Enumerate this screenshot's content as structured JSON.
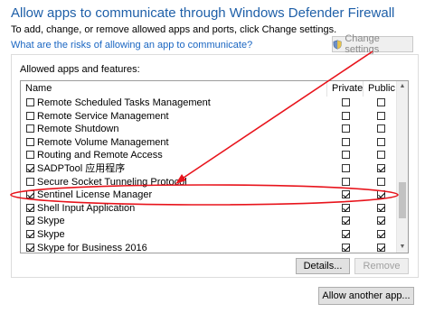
{
  "header": {
    "title": "Allow apps to communicate through Windows Defender Firewall",
    "subtitle": "To add, change, or remove allowed apps and ports, click Change settings.",
    "risk_link": "What are the risks of allowing an app to communicate?",
    "change_settings": "Change settings"
  },
  "group": {
    "label": "Allowed apps and features:",
    "columns": {
      "name": "Name",
      "private": "Private",
      "public": "Public"
    },
    "rows": [
      {
        "name": "Remote Scheduled Tasks Management",
        "enabled": false,
        "private": false,
        "public": false
      },
      {
        "name": "Remote Service Management",
        "enabled": false,
        "private": false,
        "public": false
      },
      {
        "name": "Remote Shutdown",
        "enabled": false,
        "private": false,
        "public": false
      },
      {
        "name": "Remote Volume Management",
        "enabled": false,
        "private": false,
        "public": false
      },
      {
        "name": "Routing and Remote Access",
        "enabled": false,
        "private": false,
        "public": false
      },
      {
        "name": "SADPTool 应用程序",
        "enabled": true,
        "private": false,
        "public": true
      },
      {
        "name": "Secure Socket Tunneling Protocol",
        "enabled": false,
        "private": false,
        "public": false
      },
      {
        "name": "Sentinel License Manager",
        "enabled": true,
        "private": true,
        "public": true
      },
      {
        "name": "Shell Input Application",
        "enabled": true,
        "private": true,
        "public": true
      },
      {
        "name": "Skype",
        "enabled": true,
        "private": true,
        "public": true
      },
      {
        "name": "Skype",
        "enabled": true,
        "private": true,
        "public": true
      },
      {
        "name": "Skype for Business 2016",
        "enabled": true,
        "private": true,
        "public": true
      }
    ],
    "details_button": "Details...",
    "remove_button": "Remove"
  },
  "allow_another_button": "Allow another app...",
  "annotation_color": "#e8141c"
}
